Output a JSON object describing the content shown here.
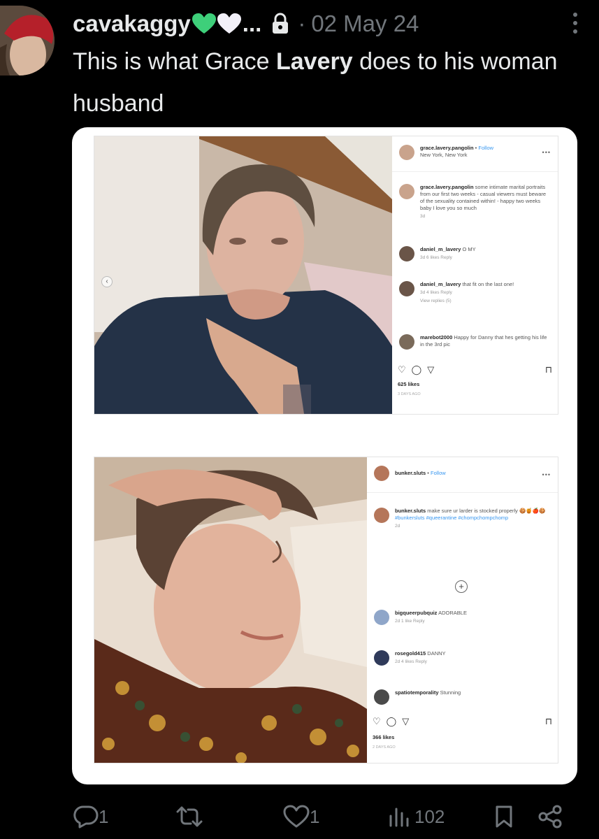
{
  "tweet": {
    "author": "cavakaggy",
    "ellipsis": "...",
    "separator": "·",
    "date": "02 May 24",
    "text_before": "This is what Grace ",
    "text_bold": "Lavery",
    "text_after": " does to his woman husband"
  },
  "post1": {
    "username": "grace.lavery.pangolin",
    "follow": "Follow",
    "location": "New York, New York",
    "caption_user": "grace.lavery.pangolin",
    "caption": "some intimate marital portraits from our first two weeks - casual viewers must beware of the sexuality contained within! - happy two weeks baby I love you so much",
    "caption_age": "3d",
    "comments": [
      {
        "user": "daniel_m_lavery",
        "text": "O MY",
        "meta": "3d   6 likes   Reply"
      },
      {
        "user": "daniel_m_lavery",
        "text": "that fit on the last one!",
        "meta": "3d   4 likes   Reply",
        "replies": "View replies (5)"
      },
      {
        "user": "marebot2000",
        "text": "Happy for Danny that hes getting his life in the 3rd pic",
        "meta": ""
      }
    ],
    "likes": "625 likes",
    "ago": "3 DAYS AGO"
  },
  "post2": {
    "username": "bunker.sluts",
    "follow": "Follow",
    "caption_user": "bunker.sluts",
    "caption": "make sure ur larder is stocked properly",
    "hashtags": "#bunkersluts #queerantine #chompchompchomp",
    "caption_age": "2d",
    "comments": [
      {
        "user": "bigqueerpubquiz",
        "text": "ADORABLE",
        "meta": "2d   1 like   Reply"
      },
      {
        "user": "rosegold415",
        "text": "DANNY",
        "meta": "2d   4 likes   Reply"
      },
      {
        "user": "spatiotemporality",
        "text": "Stunning",
        "meta": ""
      }
    ],
    "likes": "366 likes",
    "ago": "2 DAYS AGO"
  },
  "actions": {
    "replies": "1",
    "retweets": "",
    "likes": "1",
    "views": "102"
  },
  "colors": {
    "heart_green": "#3ecf7a",
    "heart_white": "#f2f0f8",
    "muted": "#71767b",
    "link_blue": "#3897f0"
  },
  "icons": [
    "reply-icon",
    "retweet-icon",
    "like-icon",
    "views-icon",
    "bookmark-icon",
    "share-icon",
    "lock-icon",
    "more-icon"
  ]
}
